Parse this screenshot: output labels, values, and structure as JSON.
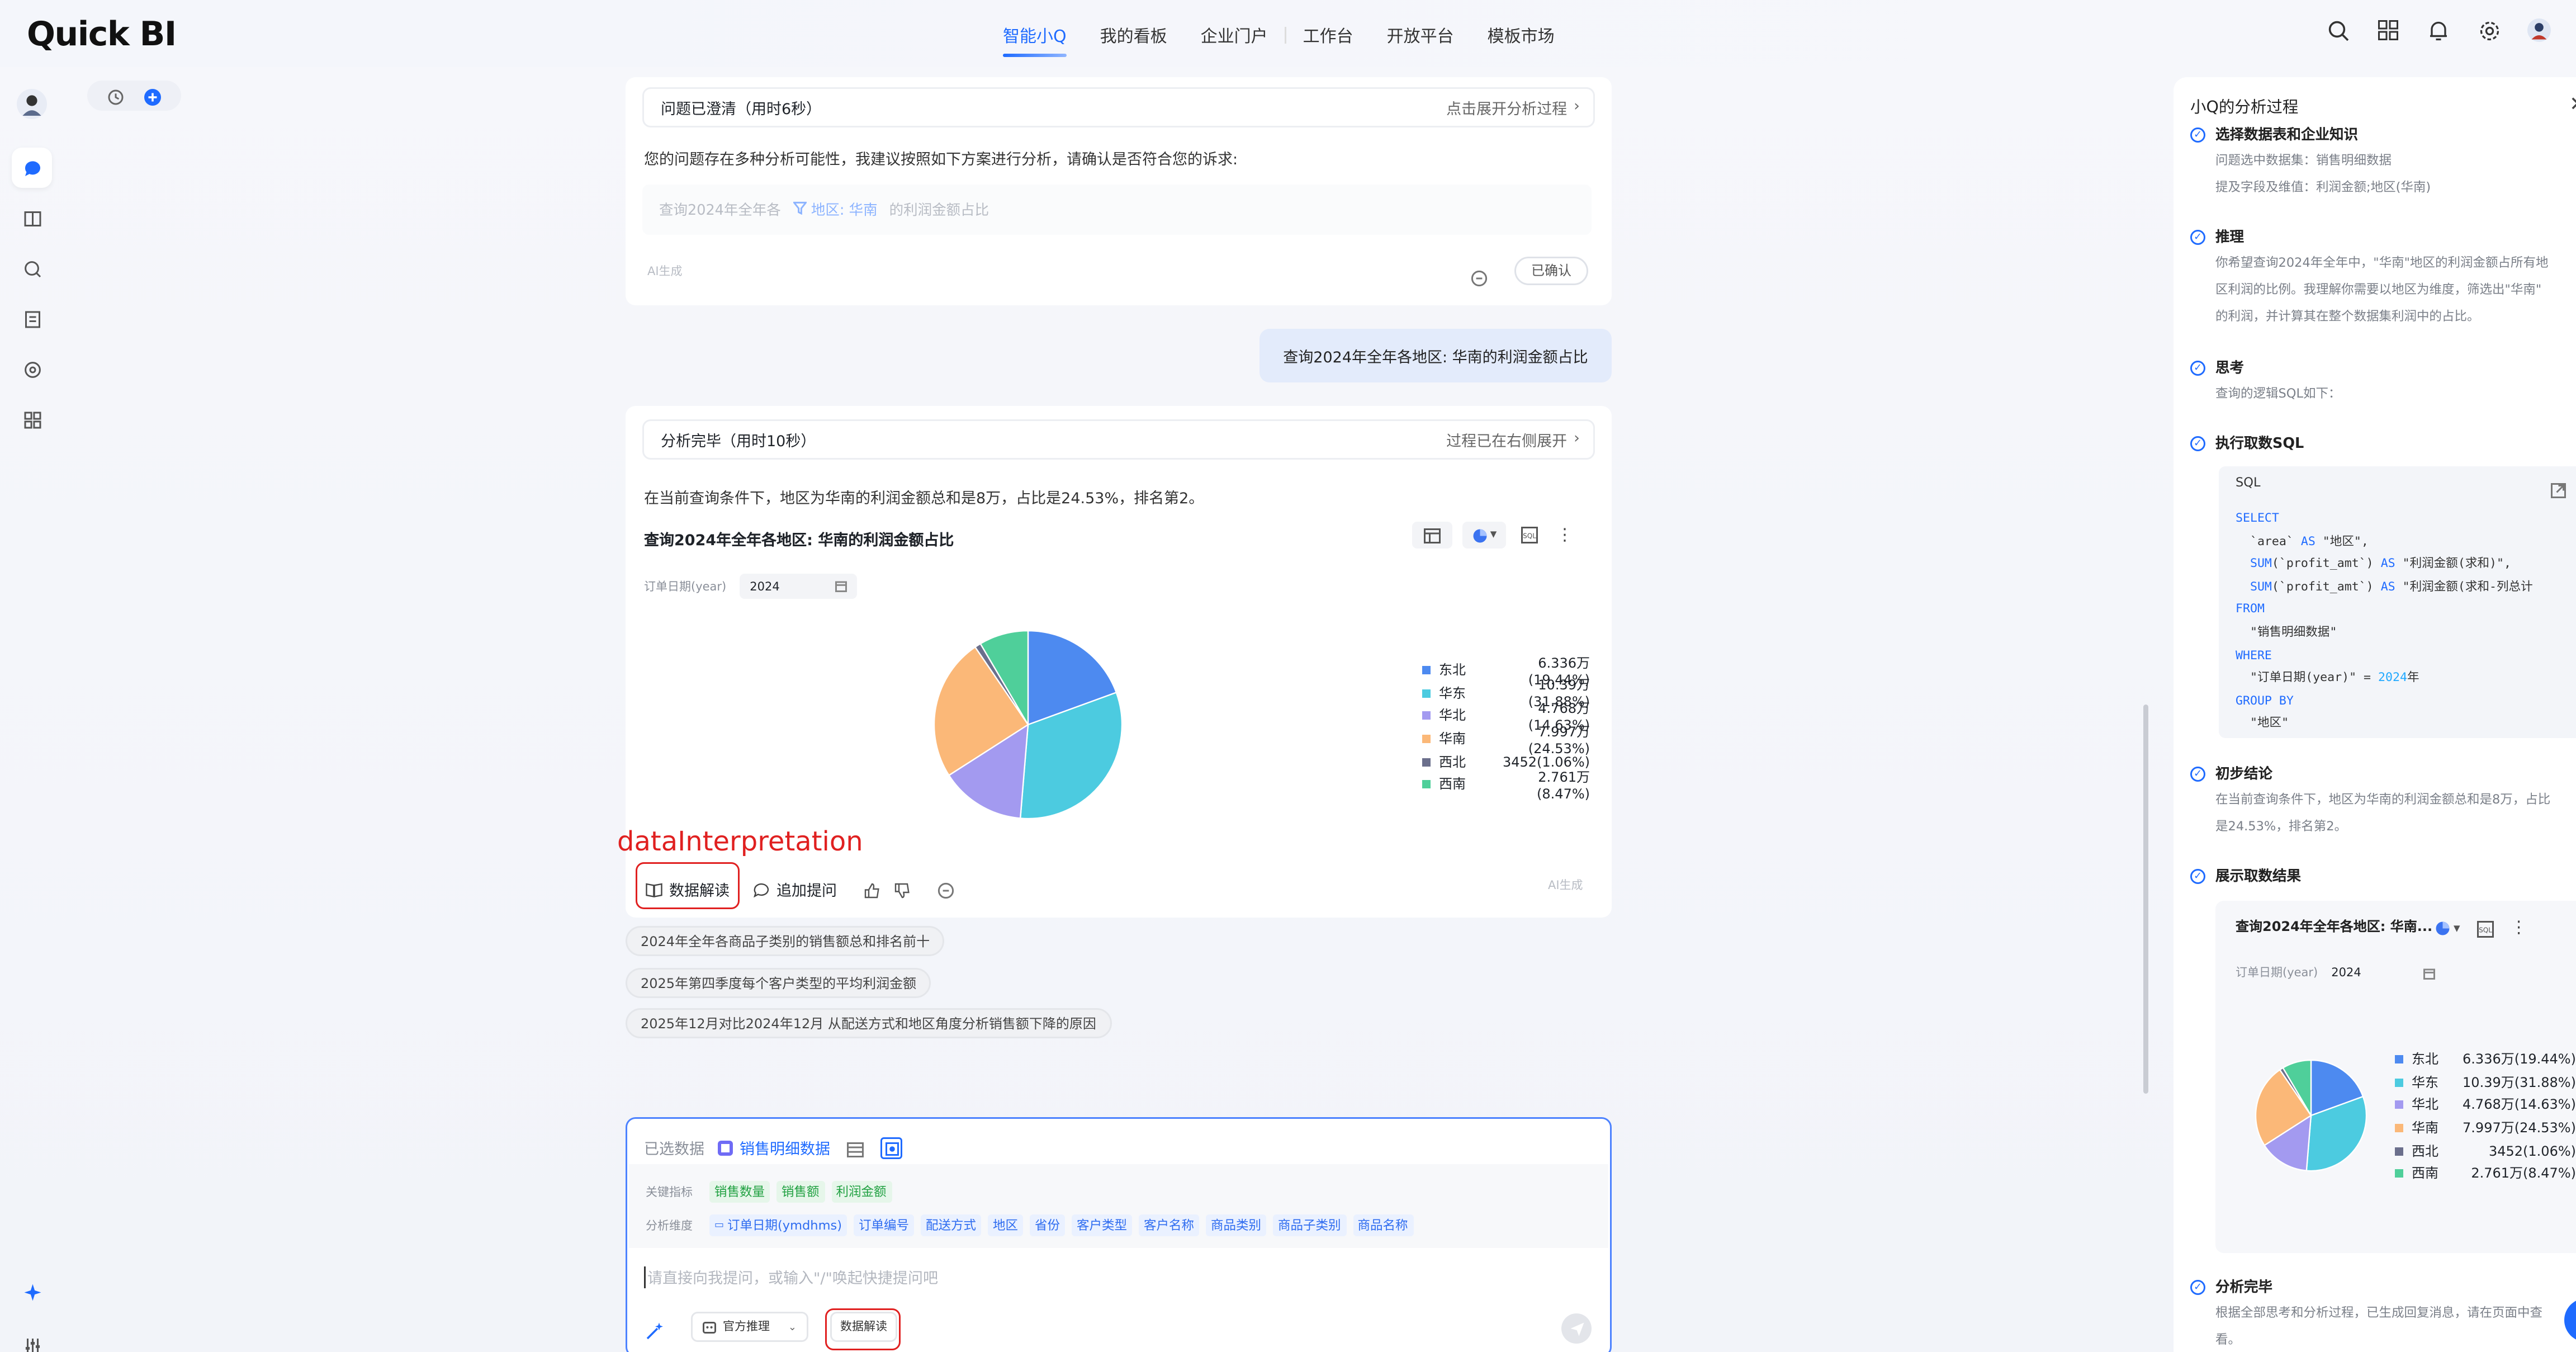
{
  "app": {
    "logo": "Quick BI"
  },
  "nav": {
    "tabs": [
      "智能小Q",
      "我的看板",
      "企业门户",
      "工作台",
      "开放平台",
      "模板市场"
    ],
    "active": 0
  },
  "clarify": {
    "status": "问题已澄清（用时6秒）",
    "expand": "点击展开分析过程",
    "intro": "您的问题存在多种分析可能性，我建议按照如下方案进行分析，请确认是否符合您的诉求:",
    "query_prefix": "查询2024年全年各",
    "filter": "地区: 华南",
    "query_suffix": "的利润金额占比",
    "ai_label": "AI生成",
    "confirm": "已确认"
  },
  "user_message": "查询2024年全年各地区: 华南的利润金额占比",
  "result": {
    "status": "分析完毕（用时10秒）",
    "expand": "过程已在右侧展开",
    "summary": "在当前查询条件下，地区为华南的利润金额总和是8万，占比是24.53%，排名第2。",
    "chart_title": "查询2024年全年各地区: 华南的利润金额占比",
    "filter_label": "订单日期(year)",
    "filter_value": "2024",
    "annotation": "dataInterpretation",
    "actions": {
      "interpret": "数据解读",
      "followup": "追加提问",
      "ai_label": "AI生成"
    }
  },
  "chart_data": [
    {
      "type": "pie",
      "categories": [
        "东北",
        "华东",
        "华北",
        "华南",
        "西北",
        "西南"
      ],
      "values": [
        63360,
        103900,
        47680,
        79970,
        3452,
        27610
      ],
      "labels": [
        "6.336万(19.44%)",
        "10.39万(31.88%)",
        "4.768万(14.63%)",
        "7.997万(24.53%)",
        "3452(1.06%)",
        "2.761万(8.47%)"
      ],
      "colors": [
        "#4d8af0",
        "#4ccbe0",
        "#a39af0",
        "#fbb878",
        "#6b6f8c",
        "#4fcf9a"
      ],
      "legend": "right"
    }
  ],
  "suggestions": [
    "2024年全年各商品子类别的销售额总和排名前十",
    "2025年第四季度每个客户类型的平均利润金额",
    "2025年12月对比2024年12月 从配送方式和地区角度分析销售额下降的原因"
  ],
  "input": {
    "selected_label": "已选数据",
    "dataset": "销售明细数据",
    "metrics_label": "关键指标",
    "metrics": [
      "销售数量",
      "销售额",
      "利润金额"
    ],
    "dims_label": "分析维度",
    "dims": [
      "订单日期(ymdhms)",
      "订单编号",
      "配送方式",
      "地区",
      "省份",
      "客户类型",
      "客户名称",
      "商品类别",
      "商品子类别",
      "商品名称"
    ],
    "placeholder": "请直接向我提问，或输入\"/\"唤起快捷提问吧",
    "recommend": "官方推理",
    "interpret_btn": "数据解读"
  },
  "panel": {
    "title": "小Q的分析过程",
    "steps": [
      {
        "title": "选择数据表和企业知识",
        "lines": [
          "问题选中数据集：销售明细数据",
          "提及字段及维值：利润金额;地区(华南)"
        ]
      },
      {
        "title": "推理",
        "lines": [
          "你希望查询2024年全年中，\"华南\"地区的利润金额占所有地",
          "区利润的比例。我理解你需要以地区为维度，筛选出\"华南\"",
          "的利润，并计算其在整个数据集利润中的占比。"
        ]
      },
      {
        "title": "思考",
        "lines": [
          "查询的逻辑SQL如下："
        ]
      },
      {
        "title": "执行取数SQL",
        "lines": []
      },
      {
        "title": "初步结论",
        "lines": [
          "在当前查询条件下，地区为华南的利润金额总和是8万，占比",
          "是24.53%，排名第2。"
        ]
      },
      {
        "title": "展示取数结果",
        "lines": []
      },
      {
        "title": "分析完毕",
        "lines": [
          "根据全部思考和分析过程，已生成回复消息，请在页面中查",
          "看。"
        ]
      }
    ],
    "sql_label": "SQL",
    "mini_chart_title": "查询2024年全年各地区: 华南...",
    "mini_filter_label": "订单日期(year)",
    "mini_filter_value": "2024"
  },
  "colors": {
    "accent": "#1f6bff",
    "annotation": "#e02020"
  }
}
